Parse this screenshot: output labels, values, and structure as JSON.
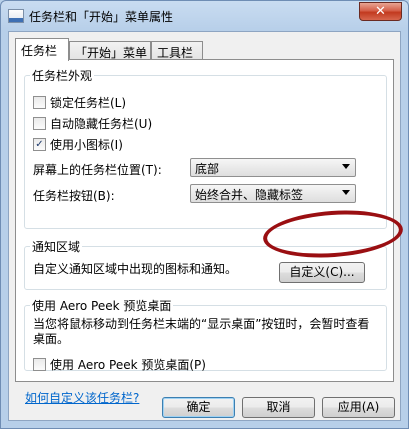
{
  "window": {
    "title": "任务栏和「开始」菜单属性",
    "close_glyph": "✕"
  },
  "tabs": [
    {
      "label": "任务栏",
      "active": true
    },
    {
      "label": "「开始」菜单",
      "active": false
    },
    {
      "label": "工具栏",
      "active": false
    }
  ],
  "appearance": {
    "legend": "任务栏外观",
    "lock_taskbar": {
      "label": "锁定任务栏(L)",
      "checked": false
    },
    "auto_hide": {
      "label": "自动隐藏任务栏(U)",
      "checked": false
    },
    "small_icons": {
      "label": "使用小图标(I)",
      "checked": true
    },
    "location_label": "屏幕上的任务栏位置(T):",
    "location_value": "底部",
    "buttons_label": "任务栏按钮(B):",
    "buttons_value": "始终合并、隐藏标签"
  },
  "notification": {
    "legend": "通知区域",
    "text": "自定义通知区域中出现的图标和通知。",
    "customize_button": "自定义(C)..."
  },
  "peek": {
    "legend": "使用 Aero Peek 预览桌面",
    "description": "当您将鼠标移动到任务栏末端的“显示桌面”按钮时，会暂时查看桌面。",
    "checkbox": {
      "label": "使用 Aero Peek 预览桌面(P)",
      "checked": false
    }
  },
  "help_link": "如何自定义该任务栏?",
  "footer": {
    "ok": "确定",
    "cancel": "取消",
    "apply": "应用(A)"
  },
  "annotation": {
    "color": "#9a0f12"
  }
}
